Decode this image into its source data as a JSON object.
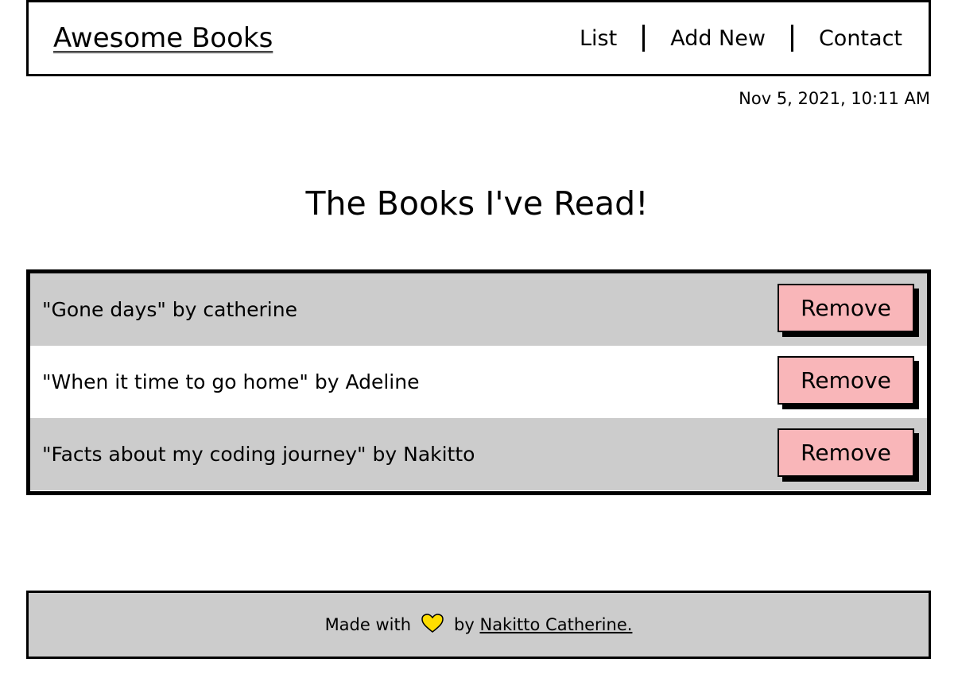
{
  "header": {
    "logo": "Awesome Books",
    "nav": [
      "List",
      "Add New",
      "Contact"
    ]
  },
  "datetime": "Nov 5, 2021, 10:11 AM",
  "main": {
    "title": "The Books I've Read!",
    "books": [
      {
        "text": "\"Gone days\" by catherine",
        "remove_label": "Remove"
      },
      {
        "text": "\"When it time to go home\" by Adeline",
        "remove_label": "Remove"
      },
      {
        "text": "\"Facts about my coding journey\" by Nakitto",
        "remove_label": "Remove"
      }
    ]
  },
  "footer": {
    "prefix": "Made with",
    "heart_icon": "heart-icon",
    "by": "by",
    "author_link": "Nakitto Catherine."
  },
  "colors": {
    "row_shaded": "#cccccc",
    "button": "#f9b6b9",
    "heart": "#ffdd00"
  }
}
